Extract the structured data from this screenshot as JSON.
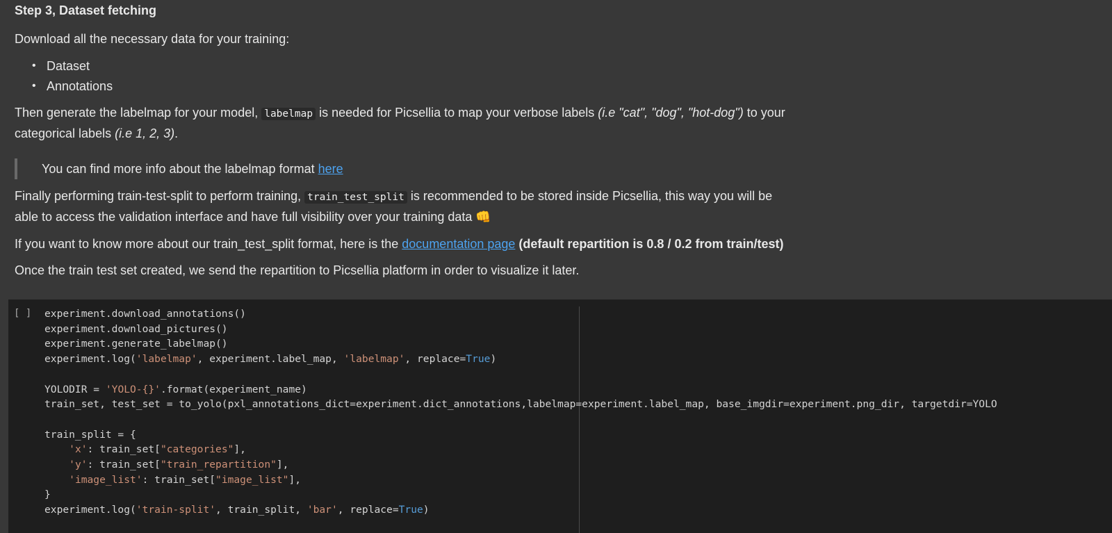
{
  "markdown": {
    "heading": "Step 3, Dataset fetching",
    "intro": "Download all the necessary data for your training:",
    "bullets": [
      "Dataset",
      "Annotations"
    ],
    "labelmap_para": {
      "part1": "Then generate the labelmap for your model, ",
      "code": "labelmap",
      "part2": " is needed for Picsellia to map your verbose labels ",
      "ital1": "(i.e \"cat\", \"dog\", \"hot-dog\")",
      "part3": " to your",
      "line2_part1": "categorical labels ",
      "ital2": "(i.e 1, 2, 3)",
      "line2_end": "."
    },
    "quote": {
      "text": "You can find more info about the labelmap format ",
      "link": "here"
    },
    "split_para": {
      "part1": "Finally performing train-test-split to perform training, ",
      "code": "train_test_split",
      "part2": " is recommended to be stored inside Picsellia, this way you will be",
      "line2": "able to access the validation interface and have full visibility over your training data 👊"
    },
    "doc_para": {
      "part1": "If you want to know more about our train_test_split format, here is the ",
      "link": "documentation page",
      "bold": " (default repartition is 0.8 / 0.2 from train/test)"
    },
    "final_para": "Once the train test set created, we send the repartition to Picsellia platform in order to visualize it later."
  },
  "code_cell": {
    "run_indicator": "[ ]",
    "lines": [
      [
        {
          "t": "experiment.download_annotations()"
        }
      ],
      [
        {
          "t": "experiment.download_pictures()"
        }
      ],
      [
        {
          "t": "experiment.generate_labelmap()"
        }
      ],
      [
        {
          "t": "experiment.log("
        },
        {
          "t": "'labelmap'",
          "c": "s"
        },
        {
          "t": ", experiment.label_map, "
        },
        {
          "t": "'labelmap'",
          "c": "s"
        },
        {
          "t": ", replace="
        },
        {
          "t": "True",
          "c": "k"
        },
        {
          "t": ")"
        }
      ],
      [
        {
          "t": ""
        }
      ],
      [
        {
          "t": "YOLODIR = "
        },
        {
          "t": "'YOLO-{}'",
          "c": "s"
        },
        {
          "t": ".format(experiment_name)"
        }
      ],
      [
        {
          "t": "train_set, test_set = to_yolo(pxl_annotations_dict=experiment.dict_annotations,labelmap=experiment.label_map, base_imgdir=experiment.png_dir, targetdir=YOLO"
        }
      ],
      [
        {
          "t": ""
        }
      ],
      [
        {
          "t": "train_split = {"
        }
      ],
      [
        {
          "t": "    "
        },
        {
          "t": "'x'",
          "c": "s"
        },
        {
          "t": ": train_set["
        },
        {
          "t": "\"categories\"",
          "c": "s"
        },
        {
          "t": "],"
        }
      ],
      [
        {
          "t": "    "
        },
        {
          "t": "'y'",
          "c": "s"
        },
        {
          "t": ": train_set["
        },
        {
          "t": "\"train_repartition\"",
          "c": "s"
        },
        {
          "t": "],"
        }
      ],
      [
        {
          "t": "    "
        },
        {
          "t": "'image_list'",
          "c": "s"
        },
        {
          "t": ": train_set["
        },
        {
          "t": "\"image_list\"",
          "c": "s"
        },
        {
          "t": "],"
        }
      ],
      [
        {
          "t": "}"
        }
      ],
      [
        {
          "t": "experiment.log("
        },
        {
          "t": "'train-split'",
          "c": "s"
        },
        {
          "t": ", train_split, "
        },
        {
          "t": "'bar'",
          "c": "s"
        },
        {
          "t": ", replace="
        },
        {
          "t": "True",
          "c": "k"
        },
        {
          "t": ")"
        }
      ]
    ]
  }
}
